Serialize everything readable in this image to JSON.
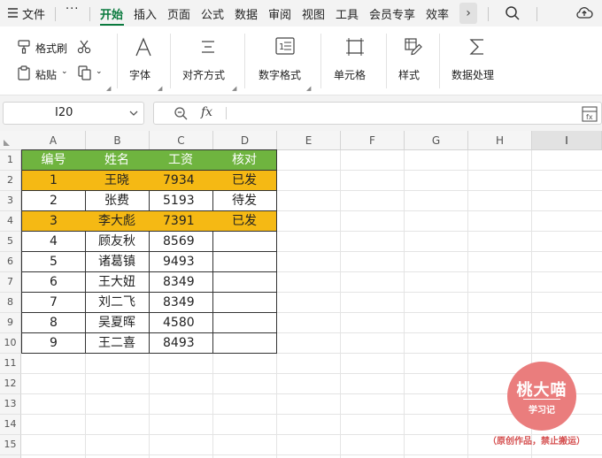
{
  "menu": {
    "file": "文件",
    "more": "···",
    "tabs": [
      "开始",
      "插入",
      "页面",
      "公式",
      "数据",
      "审阅",
      "视图",
      "工具",
      "会员专享",
      "效率"
    ],
    "more_tabs": "›"
  },
  "ribbon": {
    "format_painter": "格式刷",
    "paste": "粘贴",
    "font": "字体",
    "align": "对齐方式",
    "number_format": "数字格式",
    "cells": "单元格",
    "styles": "样式",
    "data_processing": "数据处理"
  },
  "formula_bar": {
    "cell_ref": "I20",
    "fx": "fx",
    "value": ""
  },
  "grid": {
    "columns": [
      "A",
      "B",
      "C",
      "D",
      "E",
      "F",
      "G",
      "H",
      "I"
    ],
    "selected_column": "I",
    "row_numbers": [
      "1",
      "2",
      "3",
      "4",
      "5",
      "6",
      "7",
      "8",
      "9",
      "10",
      "11",
      "12",
      "13",
      "14",
      "15",
      "16"
    ],
    "table_header": [
      "编号",
      "姓名",
      "工资",
      "核对"
    ],
    "rows": [
      [
        "1",
        "王晓",
        "7934",
        "已发"
      ],
      [
        "2",
        "张费",
        "5193",
        "待发"
      ],
      [
        "3",
        "李大彪",
        "7391",
        "已发"
      ],
      [
        "4",
        "顾友秋",
        "8569",
        ""
      ],
      [
        "5",
        "诸葛镇",
        "9493",
        ""
      ],
      [
        "6",
        "王大妞",
        "8349",
        ""
      ],
      [
        "7",
        "刘二飞",
        "8349",
        ""
      ],
      [
        "8",
        "吴夏晖",
        "4580",
        ""
      ],
      [
        "9",
        "王二喜",
        "8493",
        ""
      ]
    ],
    "highlighted_rows": [
      1,
      3
    ]
  },
  "watermark": {
    "title": "桃大喵",
    "subtitle": "学习记",
    "note": "（原创作品，禁止搬运）"
  },
  "colors": {
    "accent_green": "#0a7a3e",
    "header_green": "#6fb43f",
    "highlight_yellow": "#f5b914",
    "stamp_red": "#ea7d7d"
  }
}
